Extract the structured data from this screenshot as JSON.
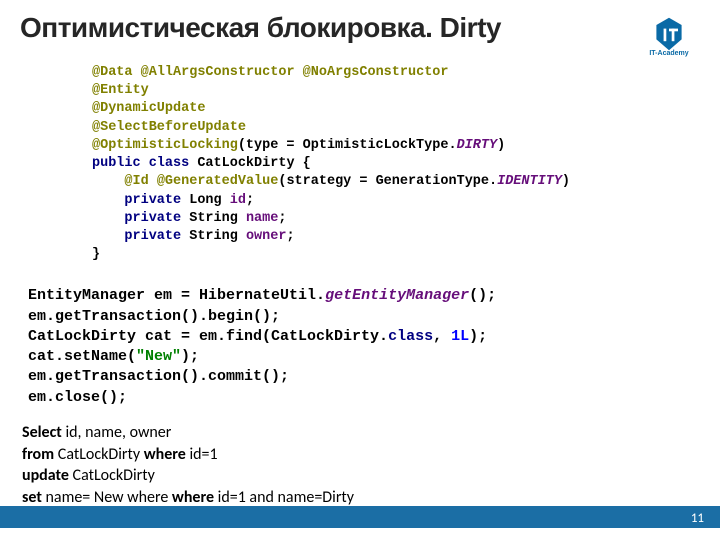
{
  "title": "Оптимистическая блокировка. Dirty",
  "logo_text": "IT-Academy",
  "page_number": "11",
  "code1": {
    "l1a": "@Data",
    "l1b": "@AllArgsConstructor",
    "l1c": "@NoArgsConstructor",
    "l2": "@Entity",
    "l3": "@DynamicUpdate",
    "l4": "@SelectBeforeUpdate",
    "l5a": "@OptimisticLocking",
    "l5b": "(type = OptimisticLockType.",
    "l5c": "DIRTY",
    "l5d": ")",
    "l6a": "public class ",
    "l6b": "CatLockDirty {",
    "l7pad": "    ",
    "l7a": "@Id",
    "l7sp": " ",
    "l7b": "@GeneratedValue",
    "l7c": "(strategy = GenerationType.",
    "l7d": "IDENTITY",
    "l7e": ")",
    "l8pad": "    ",
    "l8a": "private ",
    "l8b": "Long ",
    "l8c": "id",
    "l8d": ";",
    "l9pad": "    ",
    "l9a": "private ",
    "l9b": "String ",
    "l9c": "name",
    "l9d": ";",
    "l10pad": "    ",
    "l10a": "private ",
    "l10b": "String ",
    "l10c": "owner",
    "l10d": ";",
    "l11": "}"
  },
  "code2": {
    "l1a": "EntityManager em = HibernateUtil.",
    "l1b": "getEntityManager",
    "l1c": "();",
    "l2": "em.getTransaction().begin();",
    "l3a": "CatLockDirty cat = em.find(CatLockDirty.",
    "l3b": "class",
    "l3c": ", ",
    "l3d": "1L",
    "l3e": ");",
    "l4a": "cat.setName(",
    "l4b": "\"New\"",
    "l4c": ");",
    "l5": "em.getTransaction().commit();",
    "l6": "em.close();"
  },
  "sql": {
    "l1a": "Select",
    "l1b": " id, name, owner",
    "l2a": "from",
    "l2b": " CatLockDirty ",
    "l2c": "where",
    "l2d": " id=1",
    "l3a": "update",
    "l3b": " CatLockDirty",
    "l4a": "set",
    "l4b": " name= New where ",
    "l4c": "where",
    "l4d": " id=1 and name=Dirty"
  }
}
